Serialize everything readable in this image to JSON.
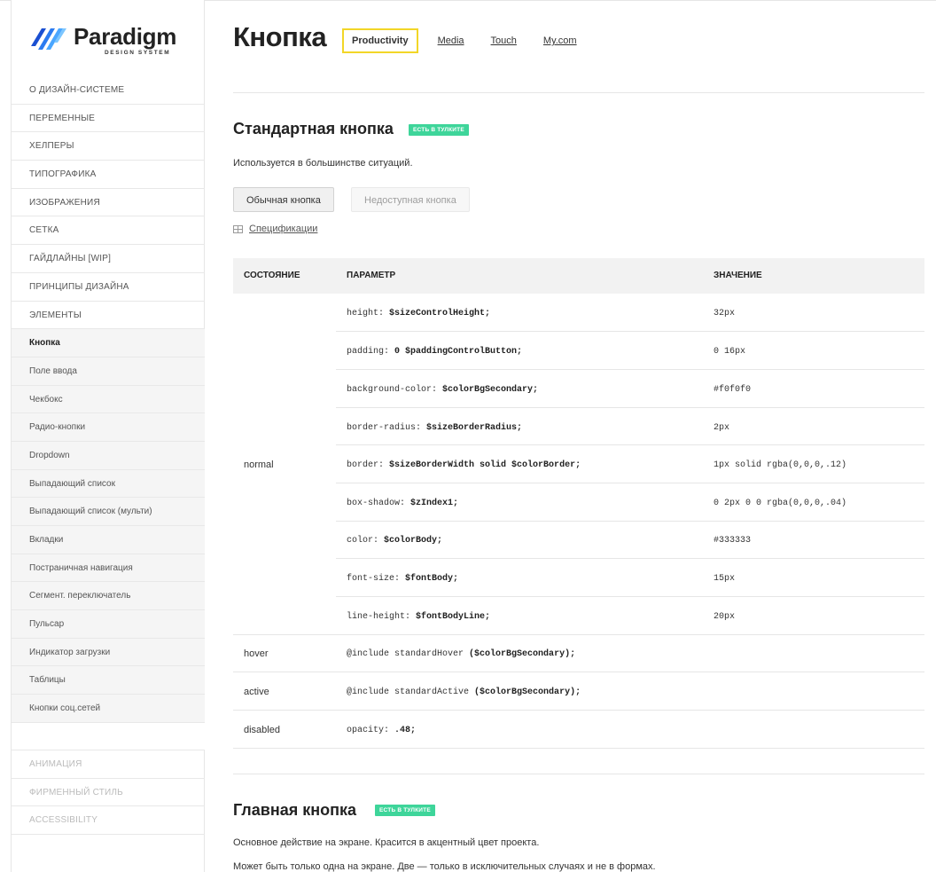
{
  "brand": {
    "name": "Paradigm",
    "subtitle": "DESIGN SYSTEM"
  },
  "sidebar": {
    "items": [
      {
        "label": "О ДИЗАЙН-СИСТЕМЕ"
      },
      {
        "label": "ПЕРЕМЕННЫЕ"
      },
      {
        "label": "ХЕЛПЕРЫ"
      },
      {
        "label": "ТИПОГРАФИКА"
      },
      {
        "label": "ИЗОБРАЖЕНИЯ"
      },
      {
        "label": "СЕТКА"
      },
      {
        "label": "ГАЙДЛАЙНЫ [WIP]"
      },
      {
        "label": "ПРИНЦИПЫ ДИЗАЙНА"
      },
      {
        "label": "ЭЛЕМЕНТЫ"
      }
    ],
    "sub_items": [
      {
        "label": "Кнопка"
      },
      {
        "label": "Поле ввода"
      },
      {
        "label": "Чекбокс"
      },
      {
        "label": "Радио-кнопки"
      },
      {
        "label": "Dropdown"
      },
      {
        "label": "Выпадающий список"
      },
      {
        "label": "Выпадающий список (мульти)"
      },
      {
        "label": "Вкладки"
      },
      {
        "label": "Постраничная навигация"
      },
      {
        "label": "Сегмент. переключатель"
      },
      {
        "label": "Пульсар"
      },
      {
        "label": "Индикатор загрузки"
      },
      {
        "label": "Таблицы"
      },
      {
        "label": "Кнопки соц.сетей"
      }
    ],
    "muted_items": [
      {
        "label": "АНИМАЦИЯ"
      },
      {
        "label": "ФИРМЕННЫЙ СТИЛЬ"
      },
      {
        "label": "ACCESSIBILITY"
      }
    ]
  },
  "header": {
    "title": "Кнопка",
    "tabs": [
      {
        "label": "Productivity"
      },
      {
        "label": "Media"
      },
      {
        "label": "Touch"
      },
      {
        "label": "My.com"
      }
    ]
  },
  "section1": {
    "title": "Стандартная кнопка",
    "badge": "ЕСТЬ В ТУЛКИТЕ",
    "description": "Используется в большинстве ситуаций.",
    "button_normal": "Обычная кнопка",
    "button_disabled": "Недоступная кнопка",
    "spec_link": "Спецификации"
  },
  "spec_table": {
    "headers": [
      "СОСТОЯНИЕ",
      "ПАРАМЕТР",
      "ЗНАЧЕНИЕ"
    ],
    "normal_state": "normal",
    "normal_rows": [
      {
        "prop": "height",
        "var": "$sizeControlHeight;",
        "value": "32px"
      },
      {
        "prop": "padding",
        "var": "0 $paddingControlButton;",
        "value": "0 16px"
      },
      {
        "prop": "background-color",
        "var": "$colorBgSecondary;",
        "value": "#f0f0f0"
      },
      {
        "prop": "border-radius",
        "var": "$sizeBorderRadius;",
        "value": "2px"
      },
      {
        "prop": "border",
        "var": "$sizeBorderWidth solid $colorBorder;",
        "value": "1px solid rgba(0,0,0,.12)"
      },
      {
        "prop": "box-shadow",
        "var": "$zIndex1;",
        "value": "0 2px 0 0 rgba(0,0,0,.04)"
      },
      {
        "prop": "color",
        "var": "$colorBody;",
        "value": "#333333"
      },
      {
        "prop": "font-size",
        "var": "$fontBody;",
        "value": "15px"
      },
      {
        "prop": "line-height",
        "var": "$fontBodyLine;",
        "value": "20px"
      }
    ],
    "other_rows": [
      {
        "state": "hover",
        "prefix": "@include standardHover",
        "arg": "($colorBgSecondary);"
      },
      {
        "state": "active",
        "prefix": "@include standardActive",
        "arg": "($colorBgSecondary);"
      },
      {
        "state": "disabled",
        "prefix": "opacity",
        "arg": ".48;"
      }
    ]
  },
  "section2": {
    "title": "Главная кнопка",
    "badge": "ЕСТЬ В ТУЛКИТЕ",
    "description_1": "Основное действие на экране. Красится в акцентный цвет проекта.",
    "description_2": "Может быть только одна на экране. Две — только в исключительных случаях и не в формах."
  },
  "colors": {
    "accent_badge": "#3ed59a",
    "tab_highlight": "#f2d627",
    "logo_blue": "#2b7bf0"
  }
}
